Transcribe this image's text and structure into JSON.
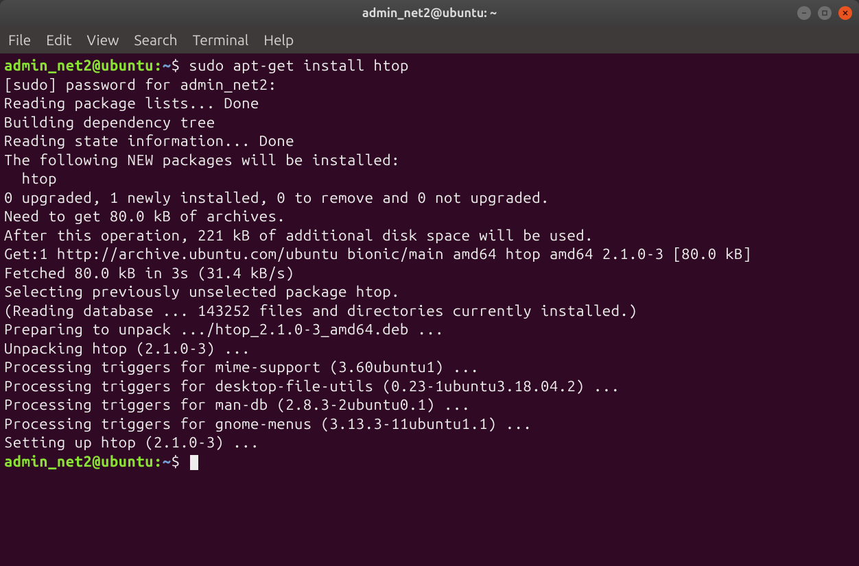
{
  "window": {
    "title": "admin_net2@ubuntu: ~"
  },
  "menubar": {
    "items": [
      "File",
      "Edit",
      "View",
      "Search",
      "Terminal",
      "Help"
    ]
  },
  "prompt": {
    "user_host": "admin_net2@ubuntu",
    "path": "~",
    "symbol": "$"
  },
  "session": {
    "command1": "sudo apt-get install htop",
    "output_lines": [
      "[sudo] password for admin_net2:",
      "Reading package lists... Done",
      "Building dependency tree",
      "Reading state information... Done",
      "The following NEW packages will be installed:",
      "  htop",
      "0 upgraded, 1 newly installed, 0 to remove and 0 not upgraded.",
      "Need to get 80.0 kB of archives.",
      "After this operation, 221 kB of additional disk space will be used.",
      "Get:1 http://archive.ubuntu.com/ubuntu bionic/main amd64 htop amd64 2.1.0-3 [80.0 kB]",
      "Fetched 80.0 kB in 3s (31.4 kB/s)",
      "Selecting previously unselected package htop.",
      "(Reading database ... 143252 files and directories currently installed.)",
      "Preparing to unpack .../htop_2.1.0-3_amd64.deb ...",
      "Unpacking htop (2.1.0-3) ...",
      "Processing triggers for mime-support (3.60ubuntu1) ...",
      "Processing triggers for desktop-file-utils (0.23-1ubuntu3.18.04.2) ...",
      "Processing triggers for man-db (2.8.3-2ubuntu0.1) ...",
      "Processing triggers for gnome-menus (3.13.3-11ubuntu1.1) ...",
      "Setting up htop (2.1.0-3) ..."
    ]
  }
}
